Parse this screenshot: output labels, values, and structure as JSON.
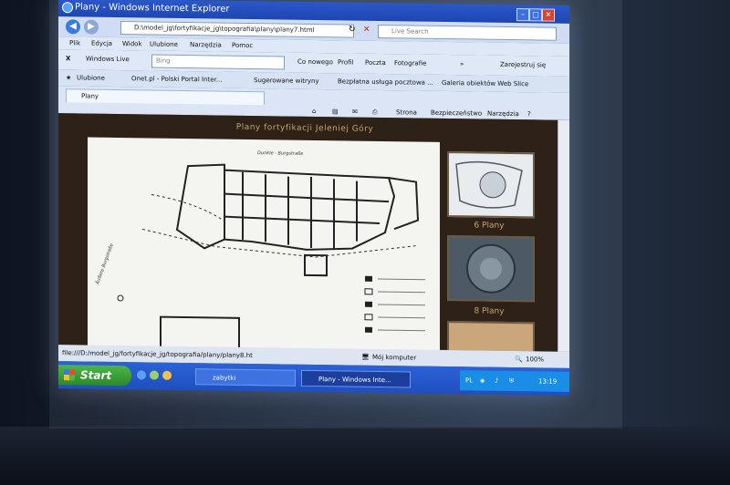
{
  "window": {
    "title": "Plany - Windows Internet Explorer"
  },
  "address": {
    "url": "D:\\model_jg\\fortyfikacje_jg\\topografia\\plany\\plany7.html"
  },
  "search": {
    "placeholder": "Live Search"
  },
  "menu": [
    "Plik",
    "Edycja",
    "Widok",
    "Ulubione",
    "Narzędzia",
    "Pomoc"
  ],
  "toolbar": {
    "close": "X",
    "windows_live": "Windows Live",
    "bing_placeholder": "Bing",
    "items": [
      "Co nowego",
      "Profil",
      "Poczta",
      "Fotografie"
    ],
    "more": "»",
    "signin": "Zarejestruj się"
  },
  "favorites": {
    "label": "Ulubione",
    "items": [
      "Onet.pl - Polski Portal Inter...",
      "Sugerowane witryny",
      "Bezpłatna usługa pocztowa ...",
      "Galeria obiektów Web Slice"
    ]
  },
  "tab": {
    "label": "Plany"
  },
  "commandbar": {
    "page": "Strona",
    "safety": "Bezpieczeństwo",
    "tools": "Narzędzia"
  },
  "page": {
    "heading": "Plany fortyfikacji Jeleniej Góry",
    "plan_title": "Dunkle - Burgstraße",
    "plan_side": "Äußere Burgstraße",
    "thumbs": [
      {
        "label": "6 Plany"
      },
      {
        "label": "8 Plany"
      }
    ]
  },
  "status": {
    "path": "file:///D:/model_jg/fortyfikacje_jg/topografia/plany/plany8.ht",
    "zone": "Mój komputer",
    "zoom": "100%"
  },
  "taskbar": {
    "start": "Start",
    "tasks": [
      "zabytki",
      "Plany - Windows Inte..."
    ],
    "lang": "PL",
    "clock": "13:19"
  }
}
